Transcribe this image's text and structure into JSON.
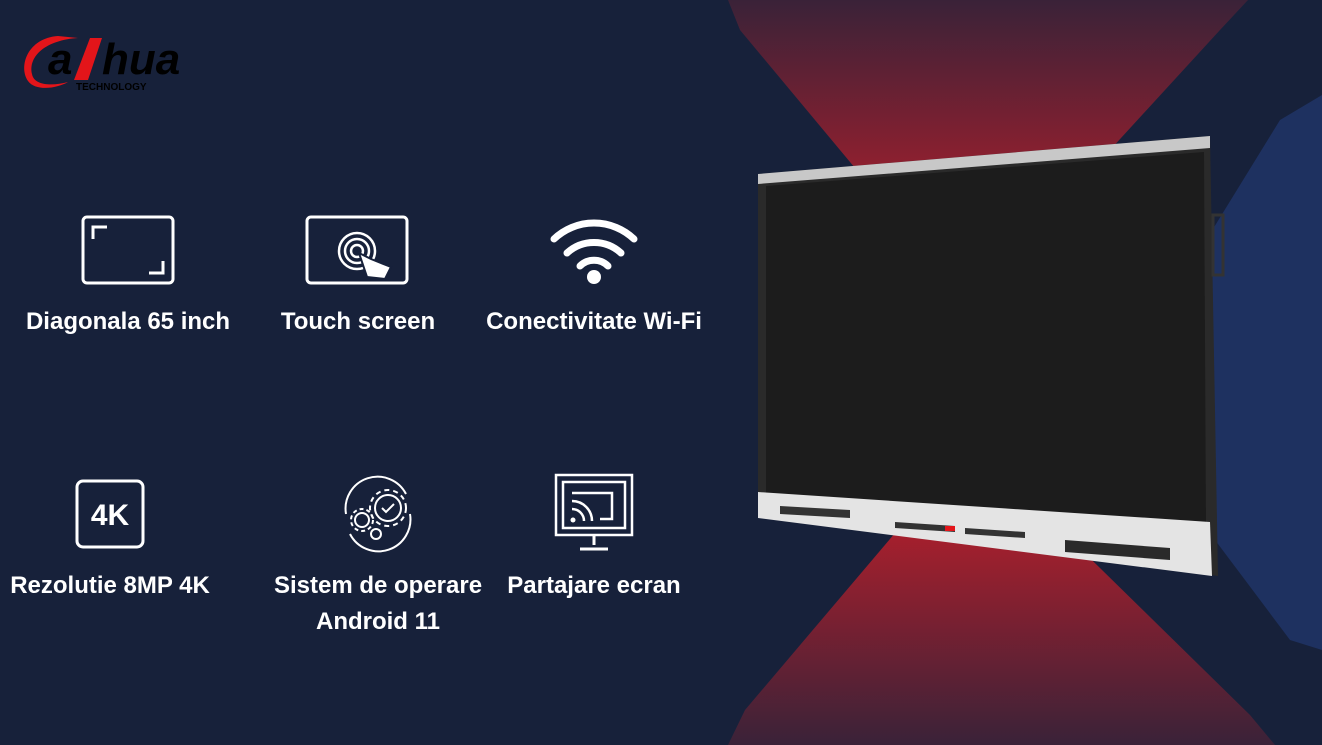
{
  "brand": {
    "name": "alhua",
    "tagline": "TECHNOLOGY",
    "colors": {
      "red": "#e3151a",
      "dark": "#000000"
    }
  },
  "background": {
    "base": "#17213a",
    "accent_red": "#c21f2a",
    "accent_blue": "#1e3160"
  },
  "features": [
    {
      "icon": "screen-corners-icon",
      "label": "Diagonala 65 inch"
    },
    {
      "icon": "touch-screen-icon",
      "label": "Touch screen"
    },
    {
      "icon": "wifi-icon",
      "label": "Conectivitate Wi-Fi"
    },
    {
      "icon": "4k-icon",
      "icon_text": "4K",
      "label": "Rezolutie 8MP 4K"
    },
    {
      "icon": "gears-icon",
      "label": "Sistem de operare Android 11"
    },
    {
      "icon": "screen-cast-icon",
      "label": "Partajare ecran"
    }
  ]
}
